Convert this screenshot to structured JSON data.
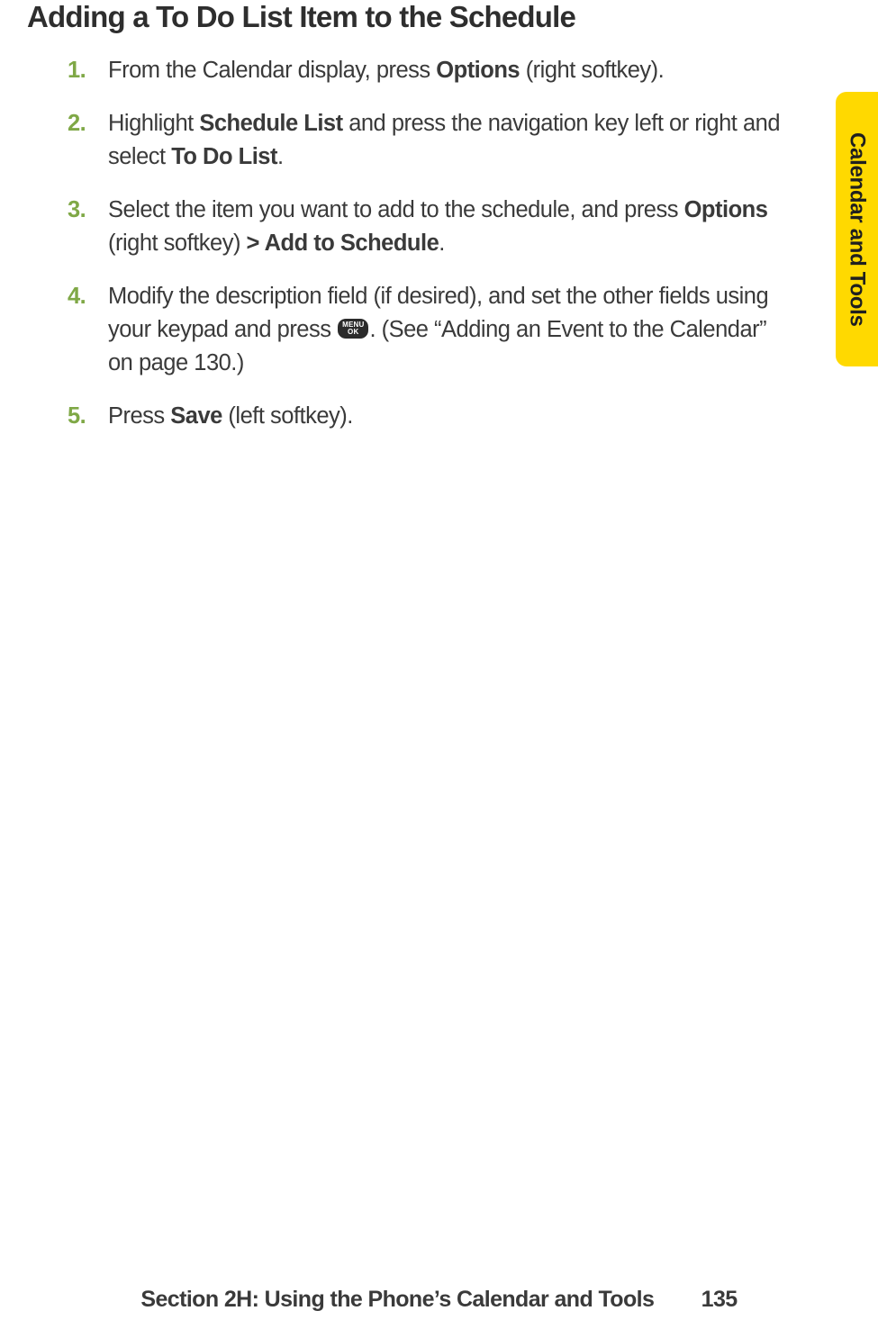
{
  "heading": "Adding a To Do List Item to the Schedule",
  "sideTab": "Calendar and Tools",
  "steps": [
    {
      "num": "1.",
      "segments": [
        {
          "t": "From the Calendar display, press "
        },
        {
          "t": "Options",
          "b": true
        },
        {
          "t": " (right softkey)."
        }
      ]
    },
    {
      "num": "2.",
      "segments": [
        {
          "t": "Highlight "
        },
        {
          "t": "Schedule List",
          "b": true
        },
        {
          "t": " and press the navigation key left or right and select "
        },
        {
          "t": "To Do List",
          "b": true
        },
        {
          "t": "."
        }
      ]
    },
    {
      "num": "3.",
      "segments": [
        {
          "t": "Select the item you want to add to the schedule, and press "
        },
        {
          "t": "Options",
          "b": true
        },
        {
          "t": " (right softkey) "
        },
        {
          "t": "> Add to Schedule",
          "b": true
        },
        {
          "t": "."
        }
      ]
    },
    {
      "num": "4.",
      "segments": [
        {
          "t": "Modify the description field (if desired), and set the other fields using your keypad and press "
        },
        {
          "icon": "menu-ok"
        },
        {
          "t": ". (See “Adding an Event to the Calendar” on page 130.)"
        }
      ]
    },
    {
      "num": "5.",
      "segments": [
        {
          "t": "Press "
        },
        {
          "t": "Save",
          "b": true
        },
        {
          "t": " (left softkey)."
        }
      ]
    }
  ],
  "menuOk": {
    "line1": "MENU",
    "line2": "OK"
  },
  "footer": {
    "section": "Section 2H: Using the Phone’s Calendar and Tools",
    "page": "135"
  }
}
